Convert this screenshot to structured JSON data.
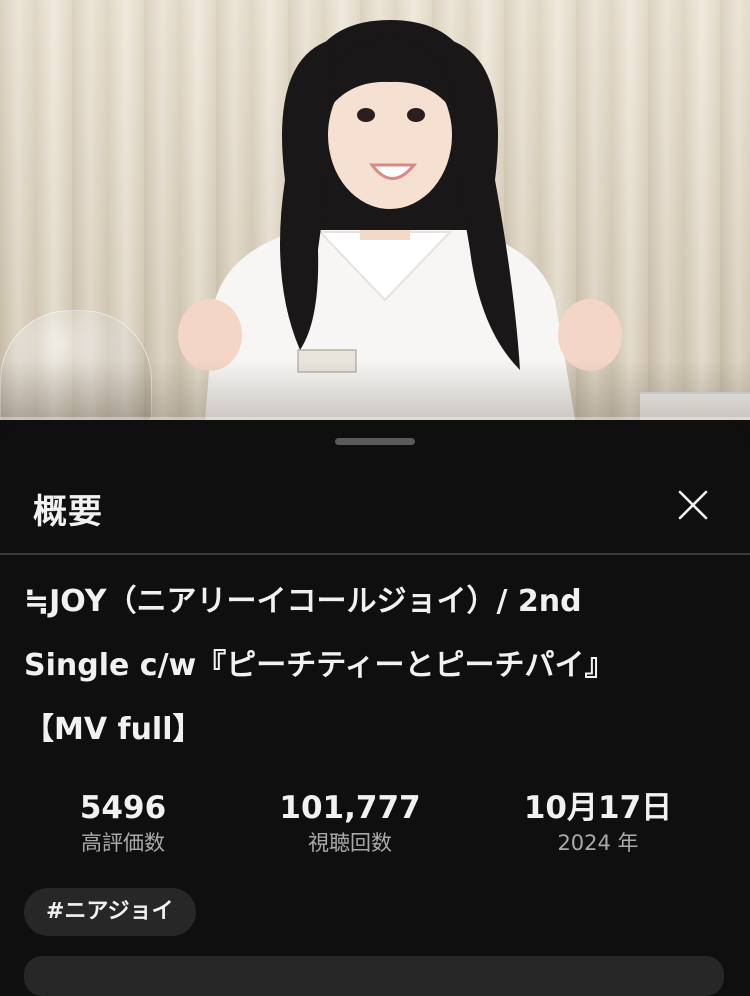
{
  "video": {
    "progress_fraction": 0.0
  },
  "sheet": {
    "title": "概要",
    "close_icon": "close-icon"
  },
  "description": {
    "title_line1": "≒JOY（ニアリーイコールジョイ）/ 2nd",
    "title_line2": "Single c/w『ピーチティーとピーチパイ』",
    "title_line3": "【MV full】"
  },
  "stats": {
    "likes_value": "5496",
    "likes_label": "高評価数",
    "views_value": "101,777",
    "views_label": "視聴回数",
    "date_value": "10月17日",
    "date_label": "2024 年"
  },
  "hashtags": [
    "#ニアジョイ"
  ],
  "colors": {
    "background": "#0f0f0f",
    "chip": "#272727",
    "text_primary": "#f1f1f1",
    "text_secondary": "#aaaaaa",
    "progress": "#ff0000"
  }
}
